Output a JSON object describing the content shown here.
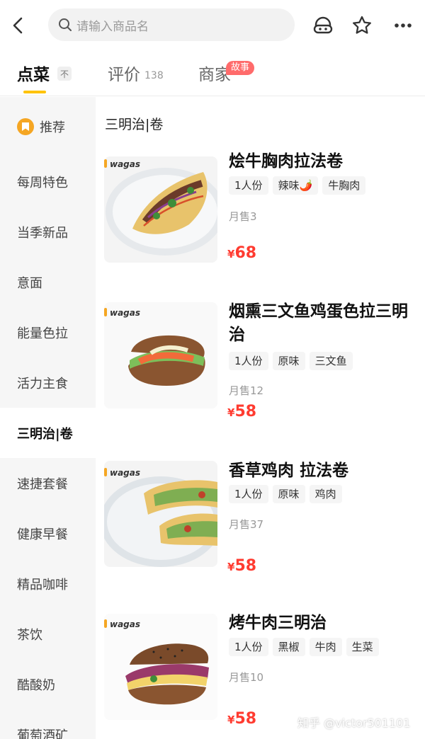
{
  "header": {
    "search_placeholder": "请输入商品名"
  },
  "tabs": [
    {
      "label": "点菜",
      "sort_badge": "不"
    },
    {
      "label": "评价",
      "count": "138"
    },
    {
      "label": "商家",
      "badge": "故事"
    }
  ],
  "sidebar": {
    "items": [
      {
        "label": "推荐"
      },
      {
        "label": "每周特色"
      },
      {
        "label": "当季新品"
      },
      {
        "label": "意面"
      },
      {
        "label": "能量色拉"
      },
      {
        "label": "活力主食"
      },
      {
        "label": "三明治|卷"
      },
      {
        "label": "速捷套餐"
      },
      {
        "label": "健康早餐"
      },
      {
        "label": "精品咖啡"
      },
      {
        "label": "茶饮"
      },
      {
        "label": "酷酸奶"
      },
      {
        "label": "葡萄酒矿"
      }
    ],
    "active_index": 6
  },
  "main": {
    "section_title": "三明治|卷",
    "items": [
      {
        "brand": "wagas",
        "name": "烩牛胸肉拉法卷",
        "tags": [
          "1人份",
          "辣味🌶️",
          "牛胸肉"
        ],
        "sold": "月售3",
        "currency": "¥",
        "price": "68"
      },
      {
        "brand": "wagas",
        "name": "烟熏三文鱼鸡蛋色拉三明治",
        "tags": [
          "1人份",
          "原味",
          "三文鱼"
        ],
        "sold": "月售12",
        "currency": "¥",
        "price": "58"
      },
      {
        "brand": "wagas",
        "name": "香草鸡肉 拉法卷",
        "tags": [
          "1人份",
          "原味",
          "鸡肉"
        ],
        "sold": "月售37",
        "currency": "¥",
        "price": "58"
      },
      {
        "brand": "wagas",
        "name": "烤牛肉三明治",
        "tags": [
          "1人份",
          "黑椒",
          "牛肉",
          "生菜"
        ],
        "sold": "月售10",
        "currency": "¥",
        "price": "58"
      }
    ]
  },
  "watermark": "知乎 @victor501101",
  "colors": {
    "accent": "#ffc300",
    "price": "#ff3b30",
    "badge": "#ff6b6b",
    "sidebar_bg": "#f6f6f6"
  }
}
